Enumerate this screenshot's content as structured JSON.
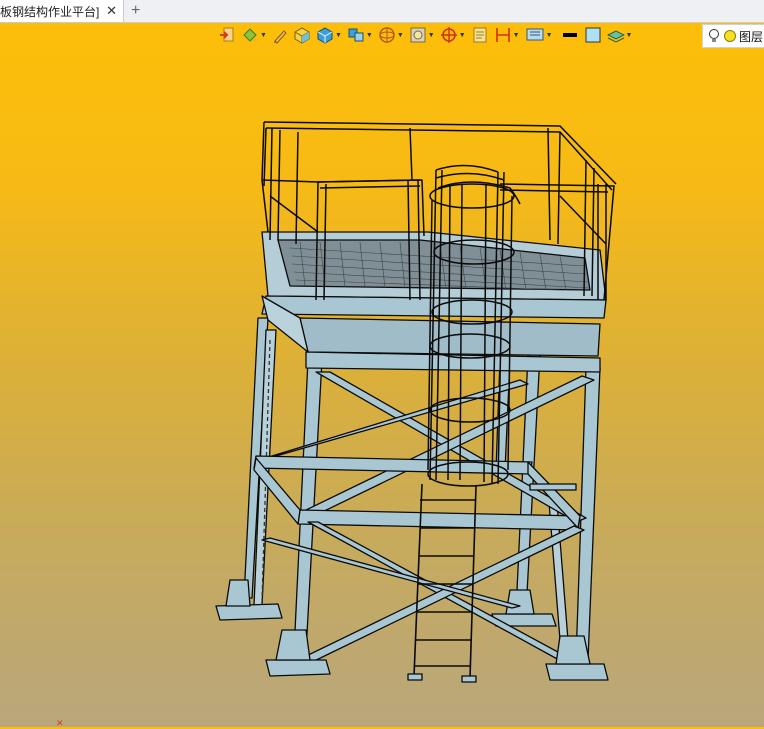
{
  "tab": {
    "title": "板钢结构作业平台]",
    "close": "✕",
    "new_tab": "+"
  },
  "toolbar": {
    "icons": [
      "import-icon",
      "paint-bucket-icon",
      "pencil-icon",
      "box-solid-icon",
      "cube-icon",
      "multi-view-icon",
      "sphere-view-icon",
      "face-view-icon",
      "target-icon",
      "note-icon",
      "dimension-icon",
      "display-settings-icon",
      "line-color-swatch",
      "fill-color-swatch",
      "layer-stack-icon"
    ],
    "line_color": "#000000",
    "fill_color": "#aee0f4"
  },
  "layer": {
    "label": "图层"
  },
  "model": {
    "steel_color": "#a9c7d2",
    "edge_color": "#0a0a0a"
  },
  "colors": {
    "bg_top": "#fdbf06",
    "bg_bottom": "#b9a77c"
  }
}
